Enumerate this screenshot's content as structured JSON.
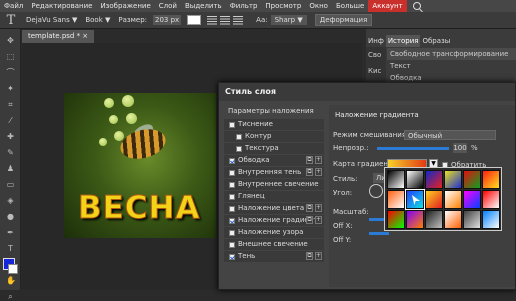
{
  "menubar": {
    "items": [
      "Файл",
      "Редактирование",
      "Изображение",
      "Слой",
      "Выделить",
      "Фильтр",
      "Просмотр",
      "Окно",
      "Больше"
    ],
    "account": "Аккаунт"
  },
  "options": {
    "font": "DejaVu Sans ▼",
    "style": "Book ▼",
    "size_label": "Размер:",
    "size_value": "203 px",
    "aa_label": "Aa:",
    "aa_value": "Sharp ▼",
    "warp": "Деформация",
    "text_color": "#ffffff"
  },
  "document": {
    "tab": "template.psd * ×",
    "canvas_text": "ВЕСНА"
  },
  "panel": {
    "side_tabs": [
      "Инф",
      "Сво",
      "Кис"
    ],
    "tabs": [
      "История",
      "Образы"
    ],
    "history": [
      "Свободное трансформирование",
      "Текст",
      "Обводка"
    ]
  },
  "dialog": {
    "title": "Стиль слоя",
    "params_header": "Параметры наложения",
    "items": [
      {
        "label": "Тиснение",
        "checked": false,
        "sub": false
      },
      {
        "label": "Контур",
        "checked": false,
        "sub": true
      },
      {
        "label": "Текстура",
        "checked": false,
        "sub": true
      },
      {
        "label": "Обводка",
        "checked": true,
        "sub": false
      },
      {
        "label": "Внутренняя тень",
        "checked": false,
        "sub": false
      },
      {
        "label": "Внутреннее свечение",
        "checked": false,
        "sub": false
      },
      {
        "label": "Глянец",
        "checked": false,
        "sub": false
      },
      {
        "label": "Наложение цвета",
        "checked": false,
        "sub": false
      },
      {
        "label": "Наложение градиента",
        "checked": true,
        "sub": false
      },
      {
        "label": "Наложение узора",
        "checked": false,
        "sub": false
      },
      {
        "label": "Внешнее свечение",
        "checked": false,
        "sub": false
      },
      {
        "label": "Тень",
        "checked": true,
        "sub": false
      }
    ],
    "section_title": "Наложение градиента",
    "blend_label": "Режим смешивания:",
    "blend_value": "Обычный",
    "opacity_label": "Непрозр.:",
    "opacity_value": "100",
    "opacity_unit": "%",
    "gradient_label": "Карта градиента:",
    "invert_label": "Обратить",
    "style_label": "Стиль:",
    "style_value": "Лин",
    "angle_label": "Угол:",
    "scale_label": "Масштаб:",
    "offx_label": "Off X:",
    "offy_label": "Off Y:"
  },
  "gradients": [
    [
      "#000000",
      "#ffffff"
    ],
    [
      "#ffffff",
      "#000000"
    ],
    [
      "#1028c8",
      "#e82020"
    ],
    [
      "#e8e020",
      "#2030d0"
    ],
    [
      "#e01010",
      "#10a020"
    ],
    [
      "#ff2010",
      "#ffe020"
    ],
    [
      "#ff6010",
      "#ffffff"
    ],
    [
      "#2040ff",
      "#10e0e0"
    ],
    [
      "#ffd020",
      "#e02020"
    ],
    [
      "#ffffff",
      "#ff8000"
    ],
    [
      "#ff00ff",
      "#0040ff"
    ],
    [
      "#ff0000",
      "#ffffff"
    ],
    [
      "#ff0000",
      "#00ff00"
    ],
    [
      "#8000ff",
      "#ff8000"
    ],
    [
      "#202020",
      "#c0c0c0"
    ],
    [
      "#ffffff",
      "#ff6000"
    ],
    [
      "#404040",
      "#e0e0e0"
    ],
    [
      "#0080ff",
      "#ffffff"
    ]
  ]
}
